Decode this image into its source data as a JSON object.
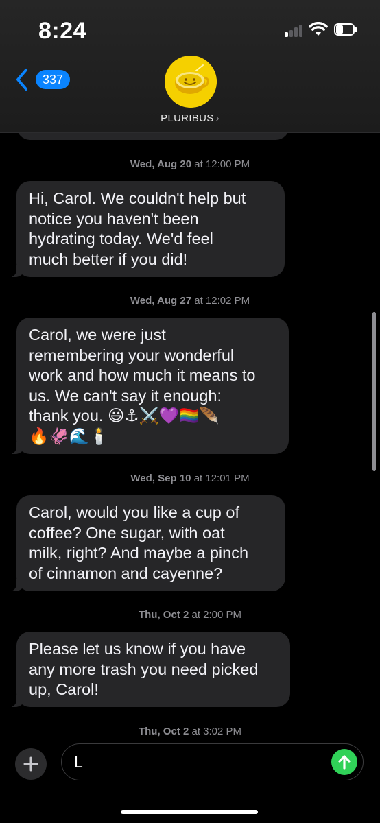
{
  "status_bar": {
    "time": "8:24",
    "signal_bars_active": 1,
    "signal_bars_total": 4,
    "battery_level": 0.4,
    "icons": [
      "signal-icon",
      "wifi-icon",
      "battery-icon"
    ]
  },
  "header": {
    "back_count": "337",
    "contact_name": "PLURIBUS",
    "chevron": "›",
    "avatar_icon": "smiley-coffee-cup-icon",
    "accent_color": "#0a84ff",
    "avatar_color": "#f5d000"
  },
  "thread": {
    "messages": [
      {
        "timestamp_day": "Wed, Aug 20",
        "timestamp_time": "at 12:00 PM",
        "text": "Hi, Carol.  We couldn't help but\nnotice you haven't been\nhydrating today.  We'd feel\nmuch better if you did!"
      },
      {
        "timestamp_day": "Wed, Aug 27",
        "timestamp_time": "at 12:02 PM",
        "text": "Carol, we were just\nremembering your wonderful\nwork and how much it means to\nus.  We can't say it enough:\nthank you.  😃⚓⚔️💜🏳️‍🌈🪶\n🔥🦑🌊🕯️"
      },
      {
        "timestamp_day": "Wed, Sep 10",
        "timestamp_time": "at 12:01 PM",
        "text": "Carol, would you like a cup of\ncoffee?  One sugar, with oat\nmilk, right?  And maybe a pinch\nof cinnamon and cayenne?"
      },
      {
        "timestamp_day": "Thu, Oct 2",
        "timestamp_time": "at 2:00 PM",
        "text": "Please let us know if you have\nany more trash you need picked\nup, Carol!"
      },
      {
        "timestamp_day": "Thu, Oct 2",
        "timestamp_time": "at 3:02 PM",
        "text": ""
      }
    ]
  },
  "composer": {
    "input_value": "L",
    "send_color": "#30d158",
    "icons": [
      "plus-icon",
      "send-arrow-icon"
    ]
  }
}
